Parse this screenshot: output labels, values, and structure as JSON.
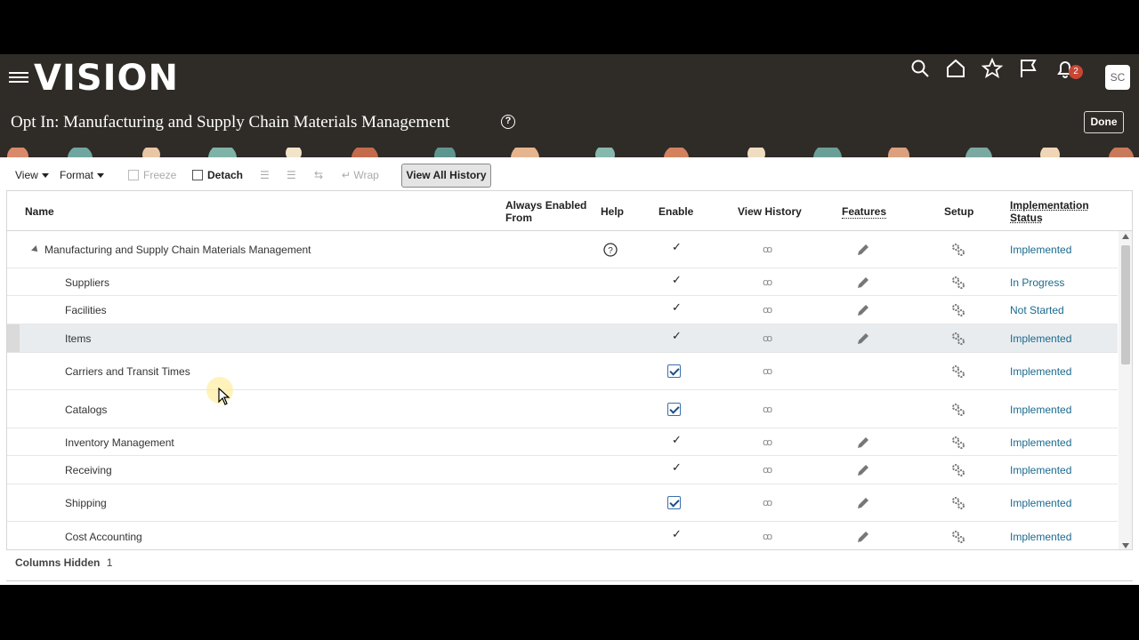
{
  "header": {
    "logo": "VISION",
    "page_title": "Opt In: Manufacturing and Supply Chain Materials Management",
    "done_label": "Done",
    "notification_count": "2",
    "avatar_initials": "SC",
    "icons": [
      "menu-icon",
      "search-icon",
      "home-icon",
      "star-icon",
      "flag-icon",
      "bell-icon"
    ]
  },
  "toolbar": {
    "view_label": "View",
    "format_label": "Format",
    "freeze_label": "Freeze",
    "detach_label": "Detach",
    "wrap_label": "Wrap",
    "view_all_history_label": "View All History"
  },
  "table": {
    "columns": {
      "name": "Name",
      "always_enabled_from": "Always Enabled From",
      "help": "Help",
      "enable": "Enable",
      "view_history": "View History",
      "features": "Features",
      "setup": "Setup",
      "implementation_status": "Implementation Status"
    },
    "rows": [
      {
        "name": "Manufacturing and Supply Chain Materials Management",
        "help": true,
        "enable": "check",
        "features": true,
        "status": "Implemented",
        "parent": true
      },
      {
        "name": "Suppliers",
        "enable": "check",
        "features": true,
        "status": "In Progress"
      },
      {
        "name": "Facilities",
        "enable": "check",
        "features": true,
        "status": "Not Started"
      },
      {
        "name": "Items",
        "enable": "check",
        "features": true,
        "status": "Implemented",
        "selected": true
      },
      {
        "name": "Carriers and Transit Times",
        "enable": "checkbox",
        "features": false,
        "status": "Implemented"
      },
      {
        "name": "Catalogs",
        "enable": "checkbox",
        "features": false,
        "status": "Implemented"
      },
      {
        "name": "Inventory Management",
        "enable": "check",
        "features": true,
        "status": "Implemented"
      },
      {
        "name": "Receiving",
        "enable": "check",
        "features": true,
        "status": "Implemented"
      },
      {
        "name": "Shipping",
        "enable": "checkbox",
        "features": true,
        "status": "Implemented"
      },
      {
        "name": "Cost Accounting",
        "enable": "check",
        "features": true,
        "status": "Implemented"
      }
    ]
  },
  "footer": {
    "columns_hidden_label": "Columns Hidden",
    "columns_hidden_count": "1"
  }
}
